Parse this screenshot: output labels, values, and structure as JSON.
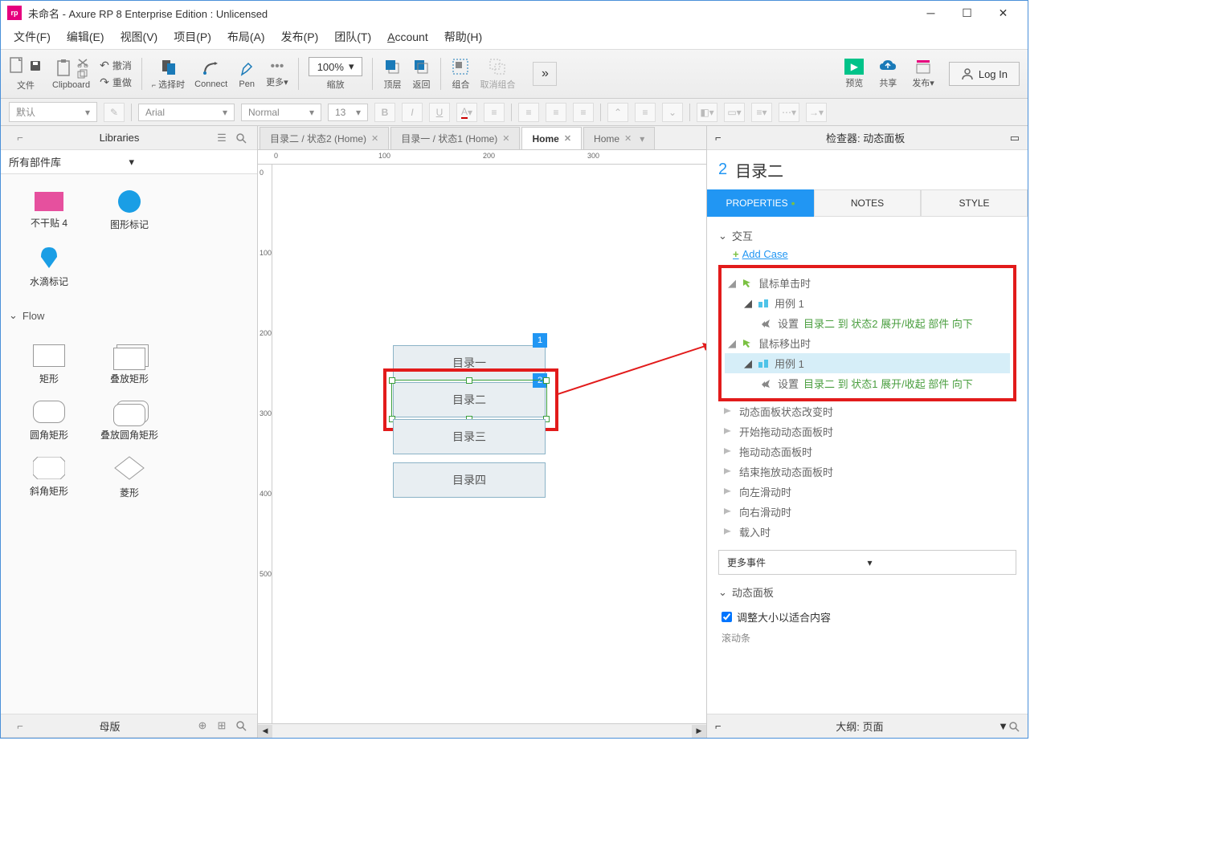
{
  "titlebar": {
    "title": "未命名 - Axure RP 8 Enterprise Edition : Unlicensed"
  },
  "menu": {
    "file": "文件(F)",
    "edit": "编辑(E)",
    "view": "视图(V)",
    "project": "项目(P)",
    "arrange": "布局(A)",
    "publish": "发布(P)",
    "team": "团队(T)",
    "account": "Account",
    "help": "帮助(H)"
  },
  "toolbar": {
    "file": "文件",
    "clipboard": "Clipboard",
    "undo": "撤消",
    "redo": "重做",
    "select": "选择时",
    "connect": "Connect",
    "pen": "Pen",
    "more": "更多▾",
    "zoom_value": "100%",
    "zoom_label": "缩放",
    "front": "顶层",
    "back": "返回",
    "group": "组合",
    "ungroup": "取消组合",
    "preview": "预览",
    "share": "共享",
    "publish": "发布▾",
    "login": "Log In"
  },
  "formatbar": {
    "style": "默认",
    "font": "Arial",
    "weight": "Normal",
    "size": "13"
  },
  "leftpanel": {
    "libraries_title": "Libraries",
    "lib_all": "所有部件库",
    "items_top": [
      {
        "label": "不干贴 4"
      },
      {
        "label": "图形标记"
      },
      {
        "label": "水滴标记"
      }
    ],
    "flow_title": "Flow",
    "flow_items": [
      {
        "label": "矩形"
      },
      {
        "label": "叠放矩形"
      },
      {
        "label": "圆角矩形"
      },
      {
        "label": "叠放圆角矩形"
      },
      {
        "label": "斜角矩形"
      },
      {
        "label": "菱形"
      }
    ],
    "masters_title": "母版"
  },
  "tabs": [
    {
      "label": "目录二 / 状态2 (Home)",
      "active": false
    },
    {
      "label": "目录一 / 状态1 (Home)",
      "active": false
    },
    {
      "label": "Home",
      "active": true
    },
    {
      "label": "Home",
      "active": false
    }
  ],
  "ruler_h": [
    "0",
    "100",
    "200",
    "300"
  ],
  "ruler_v": [
    "0",
    "100",
    "200",
    "300",
    "400",
    "500"
  ],
  "canvas": {
    "items": [
      {
        "label": "目录一",
        "badge": "1"
      },
      {
        "label": "目录二",
        "badge": "2",
        "selected": true
      },
      {
        "label": "目录三"
      },
      {
        "label": "目录四"
      }
    ]
  },
  "inspector": {
    "header": "检查器: 动态面板",
    "index": "2",
    "name": "目录二",
    "tabs": {
      "properties": "PROPERTIES",
      "notes": "NOTES",
      "style": "STYLE"
    },
    "interactions_title": "交互",
    "add_case": "Add Case",
    "events": {
      "onclick": "鼠标单击时",
      "case1": "用例 1",
      "set": "设置",
      "action1": "目录二 到 状态2 展开/收起 部件 向下",
      "onmouseout": "鼠标移出时",
      "action2": "目录二 到 状态1 展开/收起 部件 向下",
      "state_change": "动态面板状态改变时",
      "drag_start": "开始拖动动态面板时",
      "drag": "拖动动态面板时",
      "drag_end": "结束拖放动态面板时",
      "swipe_left": "向左滑动时",
      "swipe_right": "向右滑动时",
      "load": "载入时"
    },
    "more_events": "更多事件",
    "panel_section": "动态面板",
    "fit_content": "调整大小以适合内容",
    "scroll_label": "滚动条"
  },
  "outline": {
    "title": "大纲: 页面"
  }
}
